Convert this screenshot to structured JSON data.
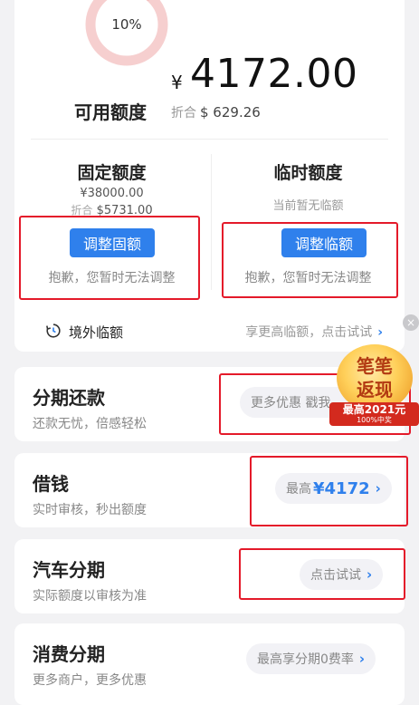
{
  "summary": {
    "progress_text": "10%",
    "progress_fraction": 0.1,
    "available_label": "可用额度",
    "currency_symbol": "¥",
    "amount": "4172.00",
    "conversion_label": "折合",
    "conversion_value": "$ 629.26"
  },
  "fixed_limit": {
    "title": "固定额度",
    "amount": "¥38000.00",
    "conversion_label": "折合",
    "conversion_value": "$5731.00",
    "button": "调整固额",
    "notice": "抱歉，您暂时无法调整"
  },
  "temp_limit": {
    "title": "临时额度",
    "status": "当前暂无临额",
    "button": "调整临额",
    "notice": "抱歉，您暂时无法调整"
  },
  "overseas": {
    "label": "境外临额",
    "hint": "享更高临额，点击试试",
    "chevron": "›"
  },
  "promo": {
    "line1": "笔笔",
    "line2": "返现",
    "ribbon": "最高2021元",
    "ribbon_sub": "100%中奖",
    "close": "×"
  },
  "features": [
    {
      "title": "分期还款",
      "subtitle": "还款无忧，倍感轻松",
      "pill": "更多优惠 戳我"
    },
    {
      "title": "借钱",
      "subtitle": "实时审核，秒出额度",
      "pill_prefix": "最高",
      "pill_value": "¥4172",
      "chevron": "›"
    },
    {
      "title": "汽车分期",
      "subtitle": "实际额度以审核为准",
      "pill": "点击试试",
      "chevron": "›"
    },
    {
      "title": "消费分期",
      "subtitle": "更多商户，更多优惠",
      "pill": "最高享分期0费率",
      "chevron": "›"
    }
  ],
  "colors": {
    "accent": "#2f80ec",
    "highlight_box": "#e41a2a",
    "ring_track": "#f6cfcf",
    "ring_progress": "#e4453b"
  }
}
